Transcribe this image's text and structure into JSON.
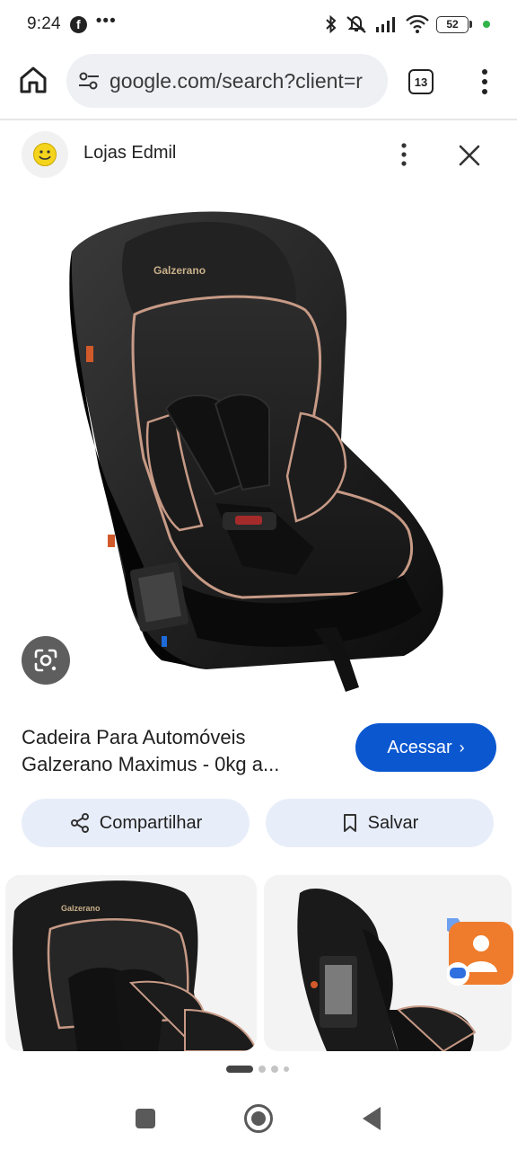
{
  "status_bar": {
    "time": "9:24",
    "notification_icons": [
      "facebook-icon",
      "more-dots-icon"
    ],
    "system_icons": [
      "bluetooth-icon",
      "mute-icon",
      "signal-icon",
      "wifi-icon"
    ],
    "battery_level": "52"
  },
  "browser": {
    "url": "google.com/search?client=r",
    "tab_count": "13"
  },
  "source": {
    "name": "Lojas Edmil"
  },
  "product": {
    "title_line1": "Cadeira Para Automóveis",
    "title_line2": "Galzerano Maximus - 0kg a...",
    "brand_on_image": "Galzerano"
  },
  "actions": {
    "access_label": "Acessar",
    "share_label": "Compartilhar",
    "save_label": "Salvar"
  },
  "thumbnails": [
    {
      "brand": "Galzerano"
    },
    {
      "brand": ""
    }
  ],
  "pager": {
    "pages": 4,
    "active_index": 0
  },
  "colors": {
    "primary_button": "#0b57d0",
    "pill_background": "#e8eef9",
    "url_background": "#eef0f4",
    "seat_trim": "#c79a86"
  }
}
